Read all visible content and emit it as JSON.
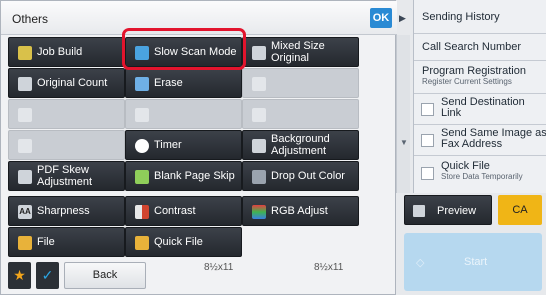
{
  "header": {
    "title": "Others",
    "ok_label": "OK"
  },
  "buttons": [
    {
      "label": "Job Build",
      "icon": "job-build-icon",
      "enabled": true
    },
    {
      "label": "Slow Scan Mode",
      "icon": "slow-scan-icon",
      "enabled": true,
      "highlighted": true
    },
    {
      "label": "Mixed Size Original",
      "icon": "mixed-size-icon",
      "enabled": true
    },
    {
      "label": "Original Count",
      "icon": "original-count-icon",
      "enabled": true
    },
    {
      "label": "Erase",
      "icon": "erase-icon",
      "enabled": true
    },
    {
      "label": "",
      "icon": "disabled-icon",
      "enabled": false
    },
    {
      "label": "",
      "icon": "disabled-icon",
      "enabled": false
    },
    {
      "label": "",
      "icon": "disabled-icon",
      "enabled": false
    },
    {
      "label": "",
      "icon": "disabled-icon",
      "enabled": false
    },
    {
      "label": "",
      "icon": "disabled-icon",
      "enabled": false
    },
    {
      "label": "Timer",
      "icon": "timer-icon",
      "enabled": true
    },
    {
      "label": "Background Adjustment",
      "icon": "background-adjust-icon",
      "enabled": true
    },
    {
      "label": "PDF Skew Adjustment",
      "icon": "pdf-skew-icon",
      "enabled": true
    },
    {
      "label": "Blank Page Skip",
      "icon": "blank-page-skip-icon",
      "enabled": true
    },
    {
      "label": "Drop Out Color",
      "icon": "drop-out-color-icon",
      "enabled": true
    },
    {
      "label": "Sharpness",
      "icon": "sharpness-icon",
      "enabled": true
    },
    {
      "label": "Contrast",
      "icon": "contrast-icon",
      "enabled": true
    },
    {
      "label": "RGB Adjust",
      "icon": "rgb-adjust-icon",
      "enabled": true
    },
    {
      "label": "File",
      "icon": "file-folder-icon",
      "enabled": true
    },
    {
      "label": "Quick File",
      "icon": "quick-file-icon",
      "enabled": true
    }
  ],
  "side": {
    "items": [
      {
        "label": "Sending History"
      },
      {
        "label": "Call Search Number"
      },
      {
        "label": "Program Registration",
        "sub": "Register Current Settings"
      },
      {
        "label": "Send Destination Link",
        "checkbox": true
      },
      {
        "label": "Send Same Image as Fax Address",
        "checkbox": true
      },
      {
        "label": "Quick File",
        "sub": "Store Data Temporarily",
        "checkbox": true
      }
    ]
  },
  "bottom": {
    "back_label": "Back",
    "paper1": "8½x11",
    "paper2": "8½x11",
    "preview_label": "Preview",
    "ca_label": "CA",
    "start_label": "Start"
  },
  "colors": {
    "accent": "#2a8ad4",
    "highlight": "#e2142d",
    "ca": "#f0b516",
    "start": "#b6d8ef"
  }
}
